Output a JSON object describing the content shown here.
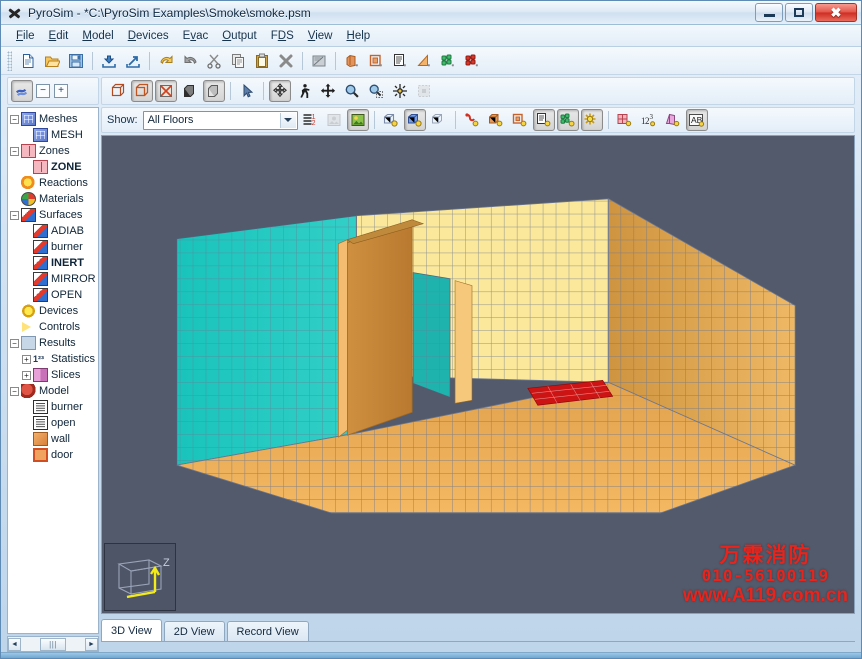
{
  "window": {
    "title": "PyroSim - *C:\\PyroSim Examples\\Smoke\\smoke.psm",
    "app_icon": "pyrosim-logo-icon",
    "controls": {
      "minimize": "minimize-icon",
      "maximize": "maximize-icon",
      "close": "close-icon"
    }
  },
  "menu": [
    {
      "label": "File",
      "mnemonic": "F"
    },
    {
      "label": "Edit",
      "mnemonic": "E"
    },
    {
      "label": "Model",
      "mnemonic": "M"
    },
    {
      "label": "Devices",
      "mnemonic": "D"
    },
    {
      "label": "Evac",
      "mnemonic": "v"
    },
    {
      "label": "Output",
      "mnemonic": "O"
    },
    {
      "label": "FDS",
      "mnemonic": "D"
    },
    {
      "label": "View",
      "mnemonic": "V"
    },
    {
      "label": "Help",
      "mnemonic": "H"
    }
  ],
  "toolbar_main": [
    {
      "name": "new-file-icon",
      "tooltip": "New"
    },
    {
      "name": "open-file-icon",
      "tooltip": "Open"
    },
    {
      "name": "save-file-icon",
      "tooltip": "Save"
    },
    {
      "name": "import-icon",
      "tooltip": "Import"
    },
    {
      "name": "export-icon",
      "tooltip": "Export"
    },
    {
      "name": "undo-icon",
      "tooltip": "Undo"
    },
    {
      "name": "redo-icon",
      "tooltip": "Redo"
    },
    {
      "name": "cut-icon",
      "tooltip": "Cut"
    },
    {
      "name": "copy-icon",
      "tooltip": "Copy"
    },
    {
      "name": "paste-icon",
      "tooltip": "Paste"
    },
    {
      "name": "delete-icon",
      "tooltip": "Delete"
    },
    {
      "name": "properties-icon",
      "tooltip": "Edit Properties"
    },
    {
      "name": "new-obstruction-icon",
      "tooltip": "New Obstruction"
    },
    {
      "name": "new-hole-icon",
      "tooltip": "New Hole"
    },
    {
      "name": "new-vent-icon",
      "tooltip": "New Vent"
    },
    {
      "name": "new-slice-icon",
      "tooltip": "New Slice"
    },
    {
      "name": "new-particles-icon",
      "tooltip": "New Particles"
    },
    {
      "name": "new-reaction-icon",
      "tooltip": "New Reaction"
    }
  ],
  "toolbar_tree": [
    {
      "name": "toggle-tree-icon",
      "pressed": true
    },
    {
      "name": "collapse-all-icon",
      "glyph": "−"
    },
    {
      "name": "expand-all-icon",
      "glyph": "+"
    }
  ],
  "toolbar_view": [
    {
      "name": "wireframe-view-icon",
      "pressed": false
    },
    {
      "name": "outline-view-icon",
      "pressed": true
    },
    {
      "name": "textured-view-icon",
      "pressed": true
    },
    {
      "name": "solid-dark-view-icon",
      "pressed": false
    },
    {
      "name": "solid-view-icon",
      "pressed": true
    },
    {
      "name": "select-tool-icon",
      "pressed": false
    },
    {
      "name": "orbit-tool-icon",
      "pressed": true
    },
    {
      "name": "walk-tool-icon",
      "pressed": false
    },
    {
      "name": "pan-tool-icon",
      "pressed": false
    },
    {
      "name": "zoom-tool-icon",
      "pressed": false
    },
    {
      "name": "zoom-region-tool-icon",
      "pressed": false
    },
    {
      "name": "center-view-icon",
      "pressed": false
    },
    {
      "name": "reset-view-icon",
      "pressed": false,
      "disabled": true
    }
  ],
  "showbar": {
    "label": "Show:",
    "floor_filter": {
      "value": "All Floors",
      "options": [
        "All Floors"
      ]
    },
    "buttons": [
      {
        "name": "floor-list-icon",
        "pressed": false
      },
      {
        "name": "background-image-icon",
        "pressed": false,
        "disabled": true
      },
      {
        "name": "show-image-icon",
        "pressed": true
      },
      {
        "name": "show-mesh-icon",
        "pressed": false
      },
      {
        "name": "show-mesh-blue-icon",
        "pressed": true
      },
      {
        "name": "show-mesh-outline-icon",
        "pressed": false
      },
      {
        "name": "show-reaction-icon",
        "pressed": false
      },
      {
        "name": "show-obstruction-icon",
        "pressed": false
      },
      {
        "name": "show-hole-icon",
        "pressed": false
      },
      {
        "name": "show-vent-icon",
        "pressed": true
      },
      {
        "name": "show-particles-icon",
        "pressed": true
      },
      {
        "name": "show-devices-icon",
        "pressed": true
      },
      {
        "name": "show-zones-icon",
        "pressed": false
      },
      {
        "name": "show-statistics-icon",
        "pressed": false
      },
      {
        "name": "show-slices-icon",
        "pressed": false
      },
      {
        "name": "show-labels-icon",
        "pressed": true
      }
    ]
  },
  "tree": [
    {
      "label": "Meshes",
      "indent": 0,
      "expander": "−",
      "icon": "mesh-icon",
      "bold": false
    },
    {
      "label": "MESH",
      "indent": 1,
      "expander": "",
      "icon": "mesh-icon",
      "bold": false
    },
    {
      "label": "Zones",
      "indent": 0,
      "expander": "−",
      "icon": "zone-icon",
      "bold": false
    },
    {
      "label": "ZONE",
      "indent": 1,
      "expander": "",
      "icon": "zone-icon",
      "bold": true
    },
    {
      "label": "Reactions",
      "indent": 0,
      "expander": "",
      "icon": "reaction-icon",
      "bold": false
    },
    {
      "label": "Materials",
      "indent": 0,
      "expander": "",
      "icon": "material-icon",
      "bold": false
    },
    {
      "label": "Surfaces",
      "indent": 0,
      "expander": "−",
      "icon": "surface-icon",
      "bold": false
    },
    {
      "label": "ADIAB",
      "indent": 1,
      "expander": "",
      "icon": "surface-icon",
      "bold": false
    },
    {
      "label": "burner",
      "indent": 1,
      "expander": "",
      "icon": "surface-icon",
      "bold": false
    },
    {
      "label": "INERT",
      "indent": 1,
      "expander": "",
      "icon": "surface-icon",
      "bold": true
    },
    {
      "label": "MIRROR",
      "indent": 1,
      "expander": "",
      "icon": "surface-icon",
      "bold": false
    },
    {
      "label": "OPEN",
      "indent": 1,
      "expander": "",
      "icon": "surface-icon",
      "bold": false
    },
    {
      "label": "Devices",
      "indent": 0,
      "expander": "",
      "icon": "device-icon",
      "bold": false
    },
    {
      "label": "Controls",
      "indent": 0,
      "expander": "",
      "icon": "control-icon",
      "bold": false
    },
    {
      "label": "Results",
      "indent": 0,
      "expander": "−",
      "icon": "results-icon",
      "bold": false
    },
    {
      "label": "Statistics",
      "indent": 1,
      "expander": "+",
      "icon": "statistics-icon",
      "bold": false
    },
    {
      "label": "Slices",
      "indent": 1,
      "expander": "+",
      "icon": "slice-icon",
      "bold": false
    },
    {
      "label": "Model",
      "indent": 0,
      "expander": "−",
      "icon": "model-icon",
      "bold": false
    },
    {
      "label": "burner",
      "indent": 1,
      "expander": "",
      "icon": "document-icon",
      "bold": false
    },
    {
      "label": "open",
      "indent": 1,
      "expander": "",
      "icon": "document-icon",
      "bold": false
    },
    {
      "label": "wall",
      "indent": 1,
      "expander": "",
      "icon": "wall-icon",
      "bold": false
    },
    {
      "label": "door",
      "indent": 1,
      "expander": "",
      "icon": "door-icon",
      "bold": false
    }
  ],
  "viewport": {
    "background_color": "#525a6b",
    "axis_widget": {
      "name": "axis-orientation-widget",
      "z_label": "Z"
    },
    "scene_colors": {
      "floor": "#eba953",
      "floor_dark": "#d99b46",
      "wall_right": "#e0a855",
      "wall_back": "#fbe89a",
      "wall_left_vent": "#2cc7bf",
      "partition": "#cf9040",
      "partition_light": "#f5c574",
      "burner_red": "#cc1414",
      "grid_line": "#6b7790"
    }
  },
  "tabs": [
    {
      "label": "3D View",
      "active": true
    },
    {
      "label": "2D View",
      "active": false
    },
    {
      "label": "Record View",
      "active": false
    }
  ],
  "tree_scrollbar": {
    "left_arrow": "◄",
    "right_arrow": "►",
    "thumb": "|||"
  },
  "watermark": {
    "line1": "万霖消防",
    "line2": "010-56100119",
    "line3": "www.A119.com.cn",
    "color": "#e8241c"
  }
}
